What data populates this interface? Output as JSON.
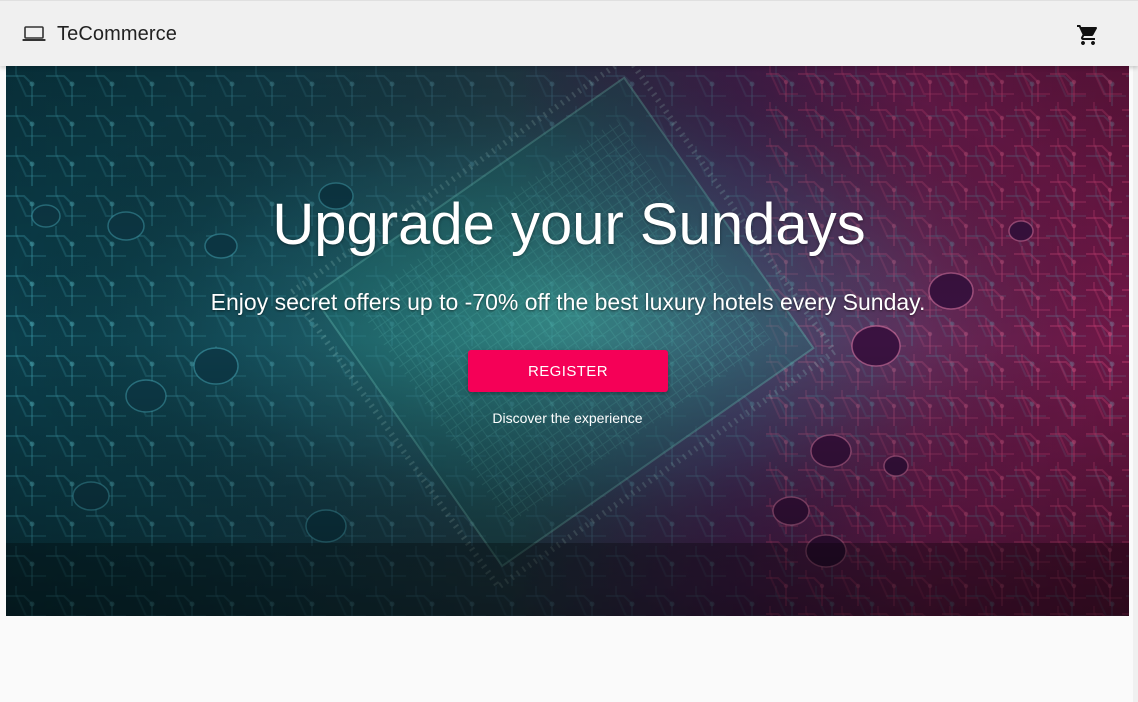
{
  "header": {
    "brand_icon": "laptop-icon",
    "brand_name": "TeCommerce",
    "cart_icon": "shopping-cart-icon"
  },
  "hero": {
    "title": "Upgrade your Sundays",
    "subtitle": "Enjoy secret offers up to -70% off the best luxury hotels every Sunday.",
    "cta_label": "REGISTER",
    "cta_color": "#f50057",
    "link_text": "Discover the experience"
  },
  "colors": {
    "topbar_bg": "#f0f0f0",
    "page_bg": "#fafafa",
    "accent": "#f50057"
  }
}
